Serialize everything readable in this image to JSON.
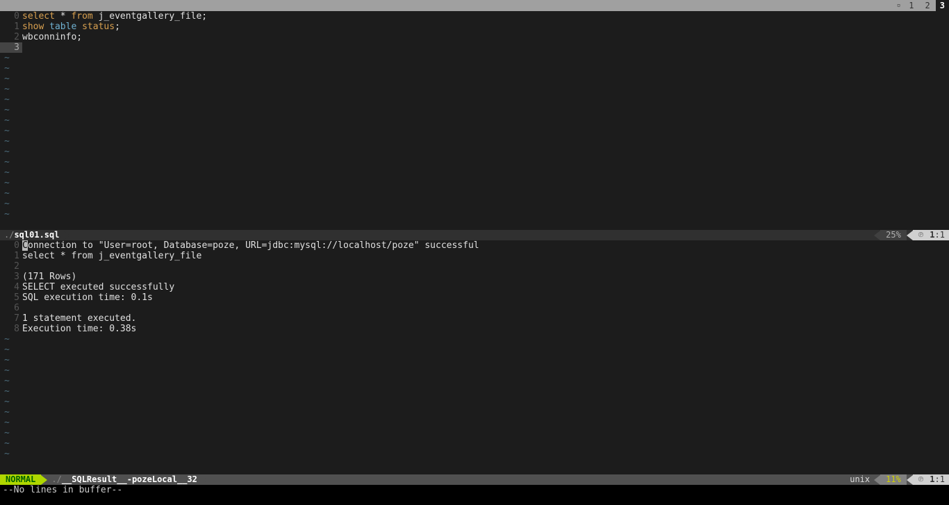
{
  "tabline": {
    "close_glyph": "▫",
    "tabs": [
      "1",
      "2",
      "3"
    ],
    "active_index": 2
  },
  "upper": {
    "lines": [
      {
        "n": "0",
        "tokens": [
          [
            "kw-orange",
            "select"
          ],
          [
            "plain",
            " * "
          ],
          [
            "kw-orange",
            "from"
          ],
          [
            "plain",
            " j_eventgallery_file;"
          ]
        ]
      },
      {
        "n": "1",
        "tokens": [
          [
            "kw-orange",
            "show"
          ],
          [
            "plain",
            " "
          ],
          [
            "kw-blue",
            "table"
          ],
          [
            "plain",
            " "
          ],
          [
            "kw-orange",
            "status"
          ],
          [
            "plain",
            ";"
          ]
        ]
      },
      {
        "n": "2",
        "tokens": [
          [
            "plain",
            "wbconninfo;"
          ]
        ]
      },
      {
        "n": "3",
        "tokens": [
          [
            "plain",
            ""
          ]
        ],
        "cursor": true
      }
    ],
    "tilde_count": 16,
    "status": {
      "path_dim": "./",
      "path_hi": "sql01.sql",
      "pct": "25%",
      "paste_glyph": "℗",
      "line": "1",
      "col": "1"
    }
  },
  "lower": {
    "lines": [
      {
        "n": "0",
        "text": "Connection to \"User=root, Database=poze, URL=jdbc:mysql://localhost/poze\" successful",
        "cursor_first": true
      },
      {
        "n": "1",
        "text": "select * from j_eventgallery_file"
      },
      {
        "n": "2",
        "text": ""
      },
      {
        "n": "3",
        "text": "(171 Rows)"
      },
      {
        "n": "4",
        "text": "SELECT executed successfully"
      },
      {
        "n": "5",
        "text": "SQL execution time: 0.1s"
      },
      {
        "n": "6",
        "text": ""
      },
      {
        "n": "7",
        "text": "1 statement executed."
      },
      {
        "n": "8",
        "text": "Execution time: 0.38s"
      }
    ],
    "tilde_count": 12,
    "status": {
      "mode": "NORMAL",
      "path_dim": "./",
      "path_hi": "__SQLResult__-pozeLocal__32",
      "unix": "unix",
      "pct": "11%",
      "paste_glyph": "℗",
      "line": "1",
      "col": "1"
    }
  },
  "cmdline": "--No lines in buffer--"
}
